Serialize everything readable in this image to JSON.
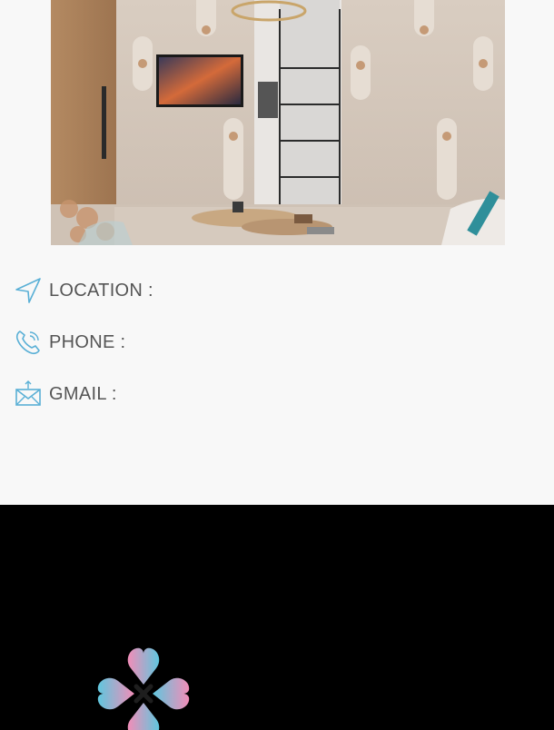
{
  "hero": {
    "image_name": "living-room-render"
  },
  "contact": {
    "items": [
      {
        "label": "LOCATION :",
        "icon": "location-arrow-icon"
      },
      {
        "label": "PHONE :",
        "icon": "phone-icon"
      },
      {
        "label": "GMAIL :",
        "icon": "mail-icon"
      }
    ],
    "icon_color": "#5ab0d6",
    "text_color": "#555555"
  },
  "footer": {
    "background": "#000000",
    "logo": "clover-logo",
    "logo_colors": [
      "#f28db8",
      "#5fc7de",
      "#1e1e1e"
    ]
  }
}
